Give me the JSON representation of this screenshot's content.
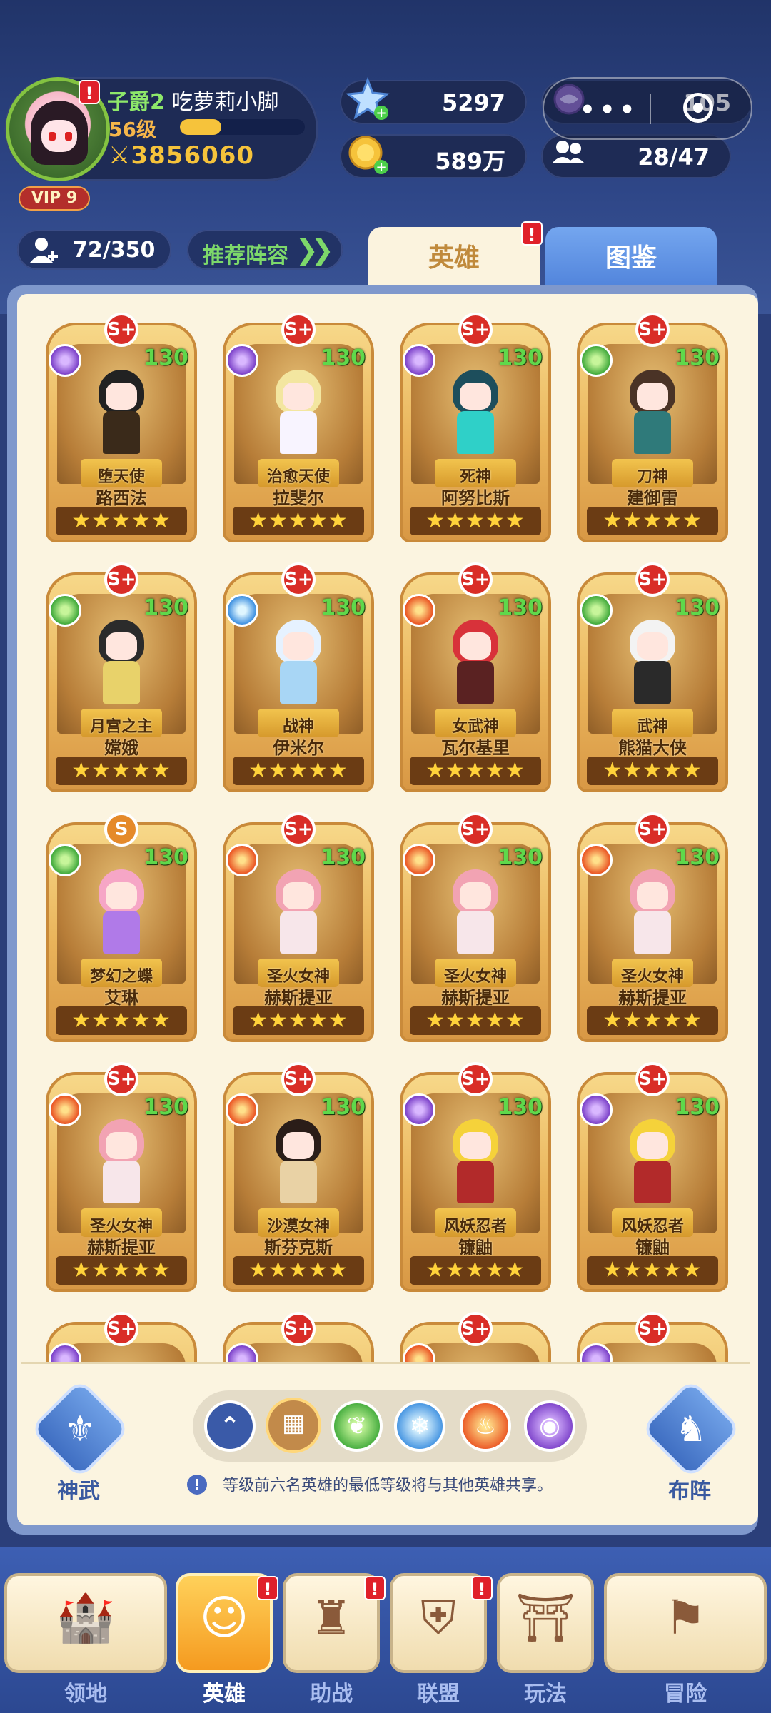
{
  "player": {
    "rank": "子爵2",
    "name": "吃萝莉小脚",
    "level": "56级",
    "xp_progress": 0.33,
    "power": "3856060",
    "vip": "VIP 9"
  },
  "resources": {
    "diamonds": "5297",
    "gold": "589万",
    "orb": "105",
    "friends": "28/47"
  },
  "hero_count": "72/350",
  "recommend_label": "推荐阵容",
  "tabs": {
    "heroes": "英雄",
    "codex": "图鉴"
  },
  "heroes": [
    {
      "grade": "S+",
      "element": "shadow",
      "level": "130",
      "title": "堕天使",
      "name": "路西法",
      "stars": "★★★★★",
      "hair": "#222222",
      "body": "#3a2a1a"
    },
    {
      "grade": "S+",
      "element": "shadow",
      "level": "130",
      "title": "治愈天使",
      "name": "拉斐尔",
      "stars": "★★★★★",
      "hair": "#f3e6a0",
      "body": "#f8f4ff"
    },
    {
      "grade": "S+",
      "element": "shadow",
      "level": "130",
      "title": "死神",
      "name": "阿努比斯",
      "stars": "★★★★★",
      "hair": "#1d4e5c",
      "body": "#2fd0c8"
    },
    {
      "grade": "S+",
      "element": "nature",
      "level": "130",
      "title": "刀神",
      "name": "建御雷",
      "stars": "★★★★★",
      "hair": "#4a3326",
      "body": "#2f7a7a"
    },
    {
      "grade": "S+",
      "element": "nature",
      "level": "130",
      "title": "月宫之主",
      "name": "嫦娥",
      "stars": "★★★★★",
      "hair": "#2b2b2b",
      "body": "#e8d26a"
    },
    {
      "grade": "S+",
      "element": "ice",
      "level": "130",
      "title": "战神",
      "name": "伊米尔",
      "stars": "★★★★★",
      "hair": "#e6f2ff",
      "body": "#a8d6f5"
    },
    {
      "grade": "S+",
      "element": "fire",
      "level": "130",
      "title": "女武神",
      "name": "瓦尔基里",
      "stars": "★★★★★",
      "hair": "#d8323a",
      "body": "#5a2222"
    },
    {
      "grade": "S+",
      "element": "nature",
      "level": "130",
      "title": "武神",
      "name": "熊猫大侠",
      "stars": "★★★★★",
      "hair": "#f3f3f3",
      "body": "#2a2a2a"
    },
    {
      "grade": "S",
      "element": "nature",
      "level": "130",
      "title": "梦幻之蝶",
      "name": "艾琳",
      "stars": "★★★★★",
      "hair": "#f6a6c6",
      "body": "#b07ae8"
    },
    {
      "grade": "S+",
      "element": "fire",
      "level": "130",
      "title": "圣火女神",
      "name": "赫斯提亚",
      "stars": "★★★★★",
      "hair": "#f2a3b3",
      "body": "#f7e6ea"
    },
    {
      "grade": "S+",
      "element": "fire",
      "level": "130",
      "title": "圣火女神",
      "name": "赫斯提亚",
      "stars": "★★★★★",
      "hair": "#f2a3b3",
      "body": "#f7e6ea"
    },
    {
      "grade": "S+",
      "element": "fire",
      "level": "130",
      "title": "圣火女神",
      "name": "赫斯提亚",
      "stars": "★★★★★",
      "hair": "#f2a3b3",
      "body": "#f7e6ea"
    },
    {
      "grade": "S+",
      "element": "fire",
      "level": "130",
      "title": "圣火女神",
      "name": "赫斯提亚",
      "stars": "★★★★★",
      "hair": "#f2a3b3",
      "body": "#f7e6ea"
    },
    {
      "grade": "S+",
      "element": "fire",
      "level": "130",
      "title": "沙漠女神",
      "name": "斯芬克斯",
      "stars": "★★★★★",
      "hair": "#2a1d18",
      "body": "#e9d2a5"
    },
    {
      "grade": "S+",
      "element": "shadow",
      "level": "130",
      "title": "风妖忍者",
      "name": "镰鼬",
      "stars": "★★★★★",
      "hair": "#f5d23a",
      "body": "#b22a2a"
    },
    {
      "grade": "S+",
      "element": "shadow",
      "level": "130",
      "title": "风妖忍者",
      "name": "镰鼬",
      "stars": "★★★★★",
      "hair": "#f5d23a",
      "body": "#b22a2a"
    },
    {
      "grade": "S+",
      "element": "shadow",
      "level": "",
      "title": "",
      "name": "",
      "stars": "",
      "hair": "#333333",
      "body": "#555555"
    },
    {
      "grade": "S+",
      "element": "shadow",
      "level": "",
      "title": "",
      "name": "",
      "stars": "",
      "hair": "#333333",
      "body": "#555555"
    },
    {
      "grade": "S+",
      "element": "fire",
      "level": "",
      "title": "",
      "name": "",
      "stars": "",
      "hair": "#333333",
      "body": "#555555"
    },
    {
      "grade": "S+",
      "element": "shadow",
      "level": "",
      "title": "",
      "name": "",
      "stars": "",
      "hair": "#333333",
      "body": "#555555"
    }
  ],
  "filters": [
    "up-arrows-icon",
    "grid-icon",
    "nature-icon",
    "ice-icon",
    "fire-icon",
    "shadow-icon"
  ],
  "controls": {
    "divine_weapon": "神武",
    "formation": "布阵"
  },
  "notice": "等级前六名英雄的最低等级将与其他英雄共享。",
  "nav": [
    {
      "label": "领地",
      "icon": "castle-icon"
    },
    {
      "label": "英雄",
      "icon": "hero-icon",
      "active": true
    },
    {
      "label": "助战",
      "icon": "banner-icon"
    },
    {
      "label": "联盟",
      "icon": "shield-crest-icon"
    },
    {
      "label": "玩法",
      "icon": "gate-icon"
    },
    {
      "label": "冒险",
      "icon": "flag-icon"
    }
  ]
}
